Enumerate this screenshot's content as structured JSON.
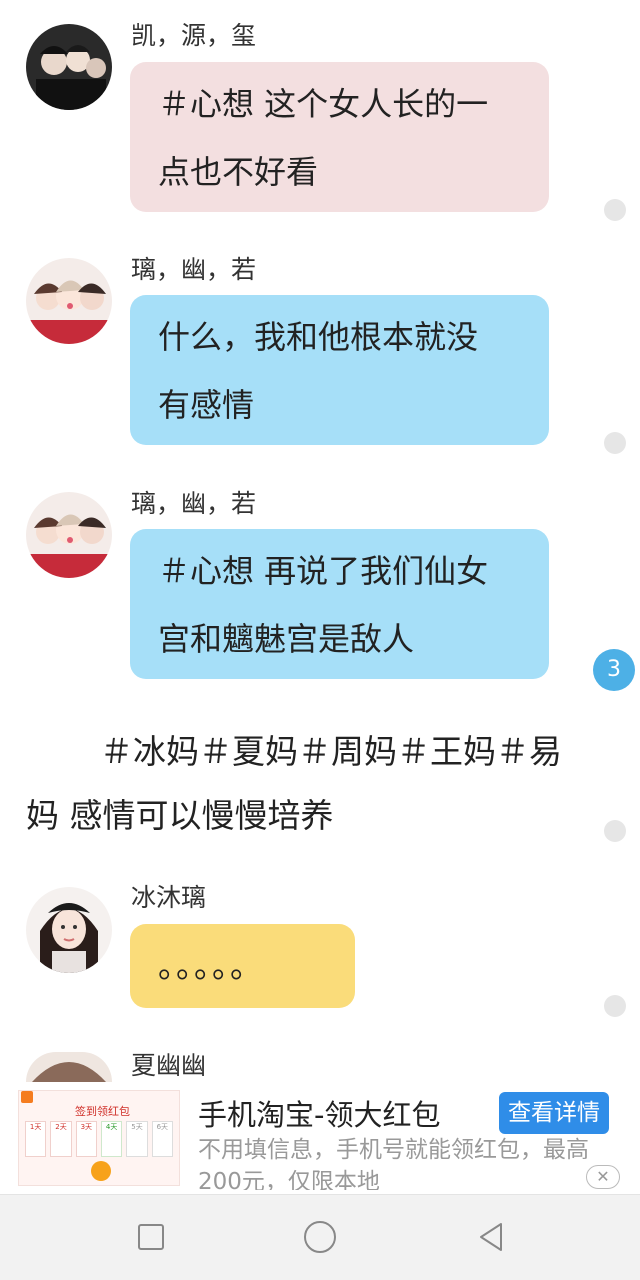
{
  "messages": [
    {
      "name": "凯，源，玺",
      "line1": "＃心想 这个女人长的一",
      "line2": "点也不好看",
      "color": "#f3dfe0"
    },
    {
      "name": "璃，幽，若",
      "line1": "什么，我和他根本就没",
      "line2": "有感情",
      "color": "#a6dff8"
    },
    {
      "name": "璃，幽，若",
      "line1": "＃心想 再说了我们仙女",
      "line2": "宫和魑魅宫是敌人",
      "color": "#a6dff8"
    },
    {
      "name": "冰沐璃",
      "line1": "。。。。。",
      "color": "#fadc7a"
    },
    {
      "name": "夏幽幽"
    }
  ],
  "unread_badge": "3",
  "plain_text": {
    "line1": "＃冰妈＃夏妈＃周妈＃王妈＃易",
    "line2": "妈 感情可以慢慢培养"
  },
  "ad": {
    "title": "手机淘宝-领大红包",
    "button": "查看详情",
    "description": "不用填信息，手机号就能领红包，最高200元，仅限本地",
    "image_caption": "签到领红包",
    "image_days": [
      "1天",
      "2天",
      "3天",
      "4天",
      "5天",
      "6天"
    ],
    "close_glyph": "✕"
  },
  "navbar": {
    "icons": [
      "square-icon",
      "circle-icon",
      "triangle-back-icon"
    ]
  }
}
